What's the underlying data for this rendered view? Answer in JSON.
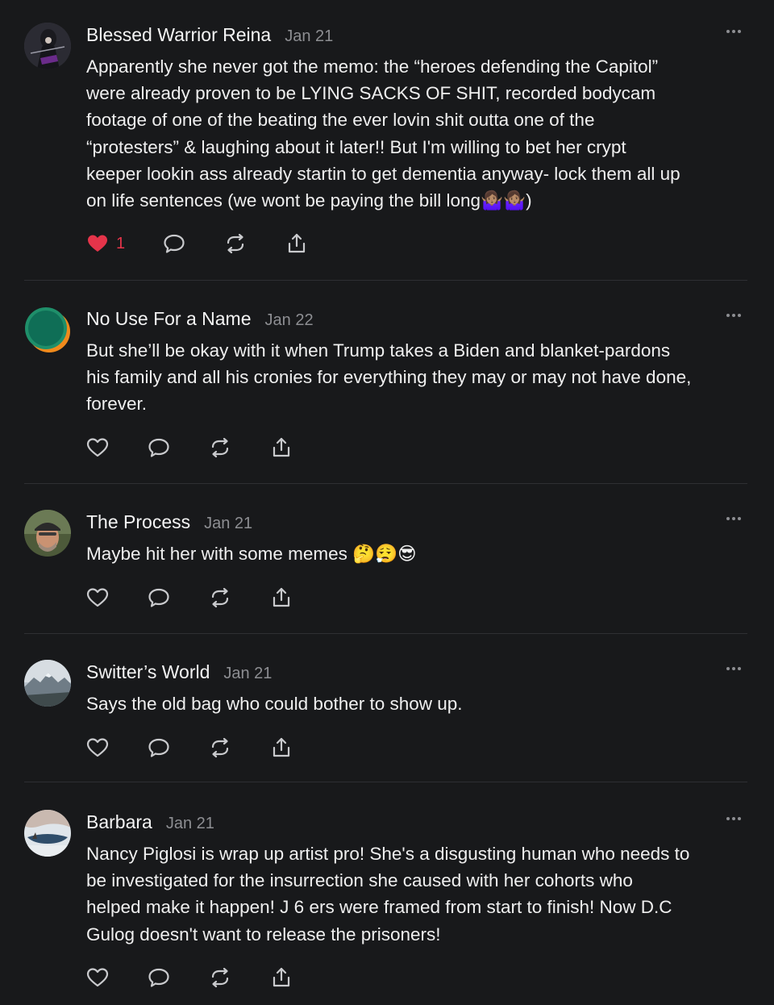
{
  "colors": {
    "background": "#18191b",
    "divider": "#2e2f33",
    "muted": "#8d8e92",
    "like_active": "#e5344a"
  },
  "comments": [
    {
      "author": "Blessed Warrior Reina",
      "date": "Jan 21",
      "text": "Apparently she never got the memo: the “heroes defending the Capitol”\nwere already proven to be LYING SACKS OF SHIT, recorded bodycam\nfootage of one of the beating the ever lovin shit outta one of the\n“protesters” & laughing about it later!! But I'm willing to bet her crypt\nkeeper lookin ass already startin to get dementia anyway- lock them all up\non life sentences (we wont be paying the bill long🤷🏽‍♀️🤷🏽‍♀️)",
      "liked": true,
      "like_count": "1",
      "avatar": "dark-warrior-avatar"
    },
    {
      "author": "No Use For a Name",
      "date": "Jan 22",
      "text": "But she’ll be okay with it when Trump takes a Biden and blanket-pardons\nhis family and all his cronies for everything they may or may not have done,\nforever.",
      "liked": false,
      "like_count": "",
      "avatar": "green-orange-circle-avatar"
    },
    {
      "author": "The Process",
      "date": "Jan 21",
      "text": "Maybe hit her with some memes 🤔😮‍💨😎",
      "liked": false,
      "like_count": "",
      "avatar": "man-with-cap-avatar"
    },
    {
      "author": "Switter’s World",
      "date": "Jan 21",
      "text": "Says the old bag who could bother to show up.",
      "liked": false,
      "like_count": "",
      "avatar": "mountain-landscape-avatar"
    },
    {
      "author": "Barbara",
      "date": "Jan 21",
      "text": "Nancy Piglosi is wrap up artist pro! She's a disgusting human who needs to\nbe investigated for the insurrection she caused with her cohorts who\nhelped make it happen! J 6 ers were framed from start to finish! Now D.C\nGulog doesn't want to release the prisoners!",
      "liked": false,
      "like_count": "",
      "avatar": "winter-lake-avatar"
    }
  ]
}
